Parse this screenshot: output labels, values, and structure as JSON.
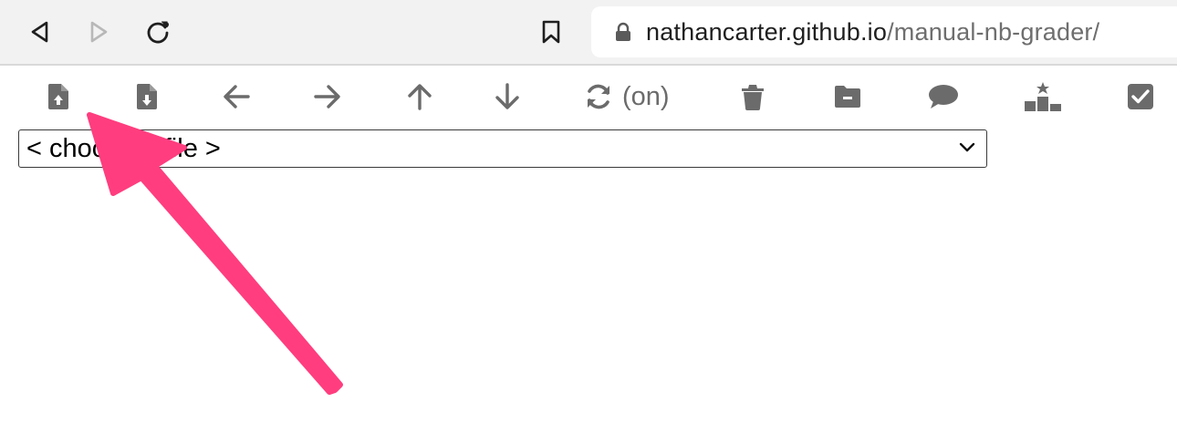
{
  "browser": {
    "back_icon": "triangle-left-icon",
    "forward_icon": "triangle-right-icon",
    "reload_icon": "reload-icon",
    "bookmark_icon": "bookmark-icon",
    "lock_icon": "lock-icon",
    "url_domain": "nathancarter.github.io",
    "url_path": "/manual-nb-grader/"
  },
  "toolbar": {
    "icons": [
      "file-upload-icon",
      "file-download-icon",
      "arrow-left-icon",
      "arrow-right-icon",
      "arrow-up-icon",
      "arrow-down-icon",
      "sync-icon",
      "trash-icon",
      "folder-minus-icon",
      "comment-icon",
      "podium-icon",
      "checkbox-icon"
    ],
    "autosave_label": "(on)"
  },
  "file_select": {
    "value": "< choose a file >"
  },
  "colors": {
    "icon_gray": "#6b6b6b",
    "annotation_arrow": "#ff3d7f"
  }
}
